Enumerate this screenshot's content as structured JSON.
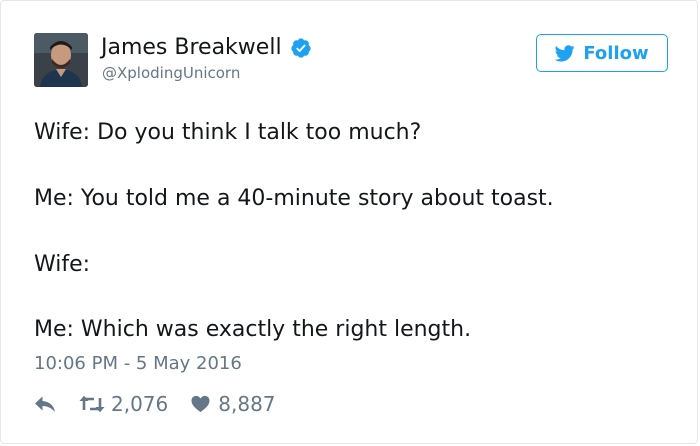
{
  "author": {
    "display_name": "James Breakwell",
    "handle": "@XplodingUnicorn",
    "verified": true
  },
  "follow_button": {
    "label": "Follow",
    "icon": "twitter-bird-icon"
  },
  "tweet": {
    "lines": [
      "Wife: Do you think I talk too much?",
      "Me: You told me a 40-minute story about toast.",
      "Wife:",
      "Me: Which was exactly the right length."
    ],
    "timestamp": "10:06 PM - 5 May 2016"
  },
  "actions": {
    "reply_icon": "reply-icon",
    "retweet_icon": "retweet-icon",
    "retweet_count": "2,076",
    "like_icon": "heart-icon",
    "like_count": "8,887"
  },
  "colors": {
    "accent": "#1da1f2",
    "text": "#14171a",
    "muted": "#657786",
    "border": "#e1e8ed"
  }
}
